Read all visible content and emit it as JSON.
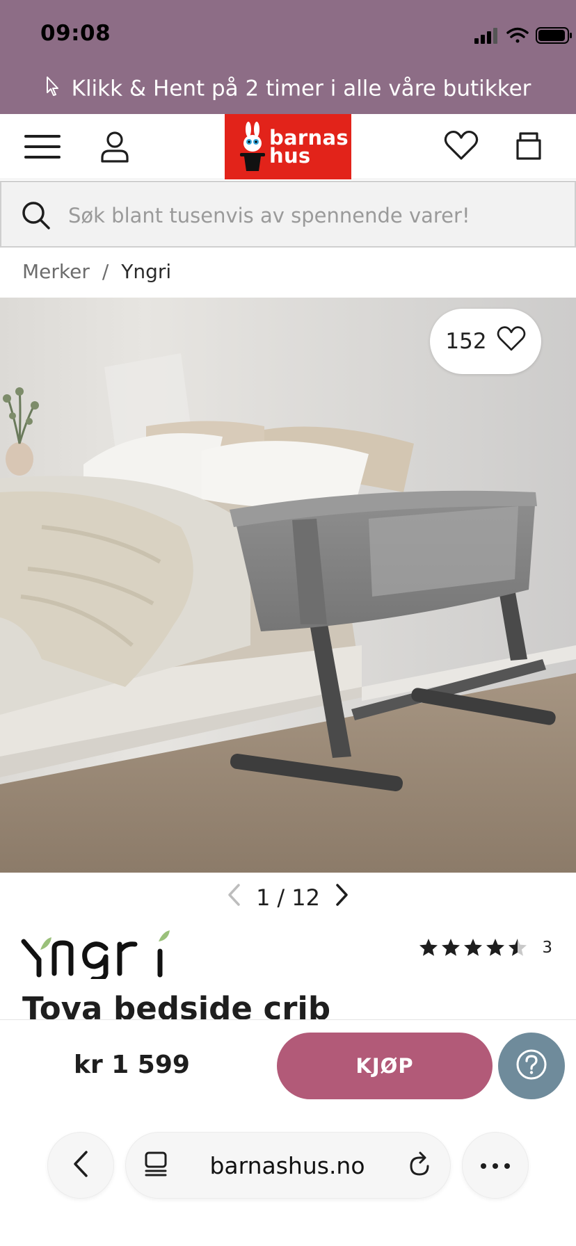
{
  "status": {
    "time": "09:08"
  },
  "promo": {
    "text": "Klikk & Hent på 2 timer i alle våre butikker"
  },
  "header": {
    "logo_line1": "barnas",
    "logo_line2": "hus"
  },
  "search": {
    "placeholder": "Søk blant tusenvis av spennende varer!"
  },
  "breadcrumb": {
    "parent": "Merker",
    "separator": "/",
    "current": "Yngri"
  },
  "gallery": {
    "favorites_count": "152",
    "current": "1",
    "separator": "/",
    "total": "12"
  },
  "product": {
    "brand": "Yngri",
    "title": "Tova bedside crib",
    "rating": 4.5,
    "review_count": "3",
    "price": "kr 1 599"
  },
  "actions": {
    "buy_label": "KJØP"
  },
  "browser": {
    "url": "barnashus.no"
  },
  "colors": {
    "top_bar": "#8d6d86",
    "logo_red": "#e2231a",
    "buy_button": "#b25a78",
    "help_button": "#6f8b9b"
  },
  "icons": [
    "cursor-icon",
    "menu-icon",
    "user-icon",
    "heart-icon",
    "bag-icon",
    "search-icon",
    "chevron-left-icon",
    "chevron-right-icon",
    "star-icon",
    "help-icon",
    "tabs-icon",
    "reload-icon",
    "more-icon"
  ]
}
